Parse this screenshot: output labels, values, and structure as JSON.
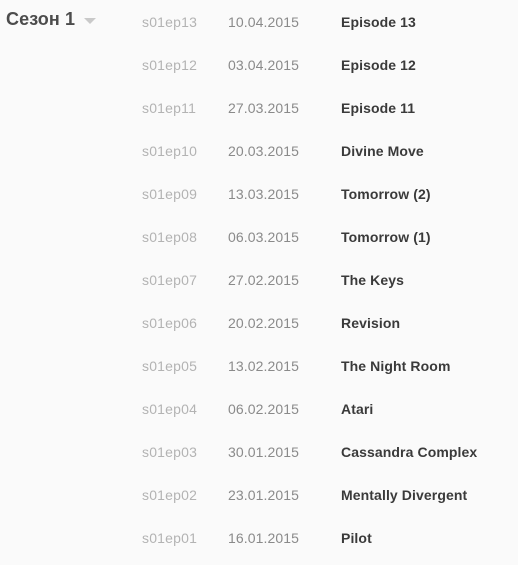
{
  "season": {
    "label": "Сезон 1",
    "caret_icon": "chevron-down-icon"
  },
  "colors": {
    "background": "#fafafa",
    "season_title": "#4c4c4c",
    "caret": "#c9c9c9",
    "episode_code": "#b3b3b3",
    "episode_date": "#8a8a8a",
    "episode_title": "#3a3a3a"
  },
  "episodes": [
    {
      "code": "s01ep13",
      "date": "10.04.2015",
      "title": "Episode 13"
    },
    {
      "code": "s01ep12",
      "date": "03.04.2015",
      "title": "Episode 12"
    },
    {
      "code": "s01ep11",
      "date": "27.03.2015",
      "title": "Episode 11"
    },
    {
      "code": "s01ep10",
      "date": "20.03.2015",
      "title": "Divine Move"
    },
    {
      "code": "s01ep09",
      "date": "13.03.2015",
      "title": "Tomorrow (2)"
    },
    {
      "code": "s01ep08",
      "date": "06.03.2015",
      "title": "Tomorrow (1)"
    },
    {
      "code": "s01ep07",
      "date": "27.02.2015",
      "title": "The Keys"
    },
    {
      "code": "s01ep06",
      "date": "20.02.2015",
      "title": "Revision"
    },
    {
      "code": "s01ep05",
      "date": "13.02.2015",
      "title": "The Night Room"
    },
    {
      "code": "s01ep04",
      "date": "06.02.2015",
      "title": "Atari"
    },
    {
      "code": "s01ep03",
      "date": "30.01.2015",
      "title": "Cassandra Complex"
    },
    {
      "code": "s01ep02",
      "date": "23.01.2015",
      "title": "Mentally Divergent"
    },
    {
      "code": "s01ep01",
      "date": "16.01.2015",
      "title": "Pilot"
    }
  ]
}
